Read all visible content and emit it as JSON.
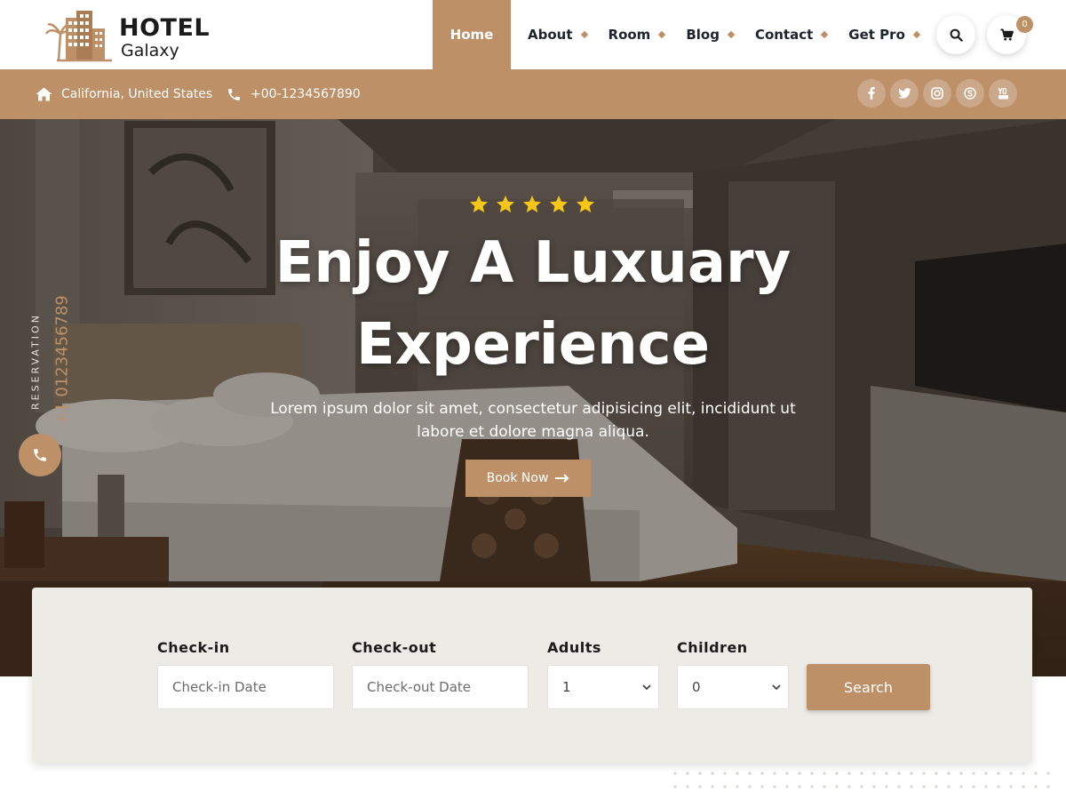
{
  "logo": {
    "title": "HOTEL",
    "subtitle": "Galaxy"
  },
  "nav": {
    "items": [
      {
        "label": "Home"
      },
      {
        "label": "About"
      },
      {
        "label": "Room"
      },
      {
        "label": "Blog"
      },
      {
        "label": "Contact"
      },
      {
        "label": "Get Pro"
      }
    ],
    "cart_count": "0"
  },
  "infobar": {
    "location": "California, United States",
    "phone": "+00-1234567890",
    "social_icons": [
      "facebook-icon",
      "twitter-icon",
      "instagram-icon",
      "skype-icon",
      "youtube-icon"
    ]
  },
  "hero": {
    "stars": 5,
    "title_line1": "Enjoy A Luxuary",
    "title_line2": "Experience",
    "text_line1": "Lorem ipsum dolor sit amet, consectetur adipisicing elit, incididunt ut",
    "text_line2": "labore et dolore magna aliqua.",
    "button_label": "Book Now",
    "reservation_label": "RESERVATION",
    "reservation_phone": "+1 0123456789"
  },
  "booking": {
    "checkin_label": "Check-in",
    "checkin_placeholder": "Check-in Date",
    "checkout_label": "Check-out",
    "checkout_placeholder": "Check-out Date",
    "adults_label": "Adults",
    "adults_value": "1",
    "children_label": "Children",
    "children_value": "0",
    "search_label": "Search"
  },
  "colors": {
    "accent": "#bd9068",
    "dark": "#1c2430",
    "star": "#f5c518"
  }
}
